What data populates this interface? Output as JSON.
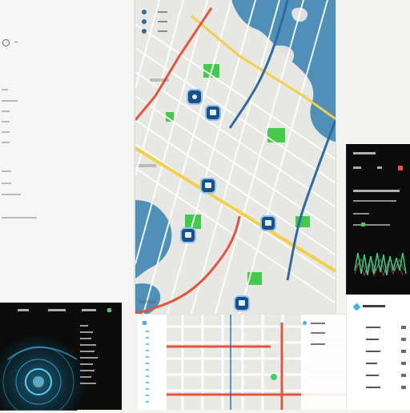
{
  "left_sidebar": {
    "items": [
      "",
      "",
      "",
      "",
      "",
      "",
      "",
      "",
      "",
      "",
      ""
    ]
  },
  "left_dark_panel": {
    "tabs": [
      "",
      "",
      "",
      ""
    ],
    "rows": [
      "",
      "",
      "",
      "",
      "",
      "",
      "",
      "",
      "",
      "",
      "",
      "",
      "",
      ""
    ]
  },
  "map": {
    "top_legend": [
      "",
      "",
      ""
    ],
    "labels": [
      "",
      ""
    ]
  },
  "right_dark_panel": {
    "title": "",
    "tabs": [
      "",
      "",
      ""
    ],
    "subtitle": "",
    "rows": [
      "",
      "",
      ""
    ],
    "bar_label": ""
  },
  "right_light_panel": {
    "title": "",
    "rows": [
      "",
      "",
      "",
      "",
      "",
      ""
    ]
  },
  "bottom_map_legend": {
    "rows": [
      "",
      "",
      ""
    ]
  },
  "colors": {
    "water": "#4f8fb8",
    "road_major": "#f2d04a",
    "road_red": "#e5543c",
    "road_blue": "#2f6aa6",
    "park": "#45c94a",
    "marker": "#1c4f86",
    "accent_green": "#3bd16a",
    "accent_cyan": "#39b8e8"
  },
  "icons": {
    "marker": "map-pin-icon",
    "left_brand": "app-logo-icon",
    "right_cyan": "diamond-icon"
  }
}
